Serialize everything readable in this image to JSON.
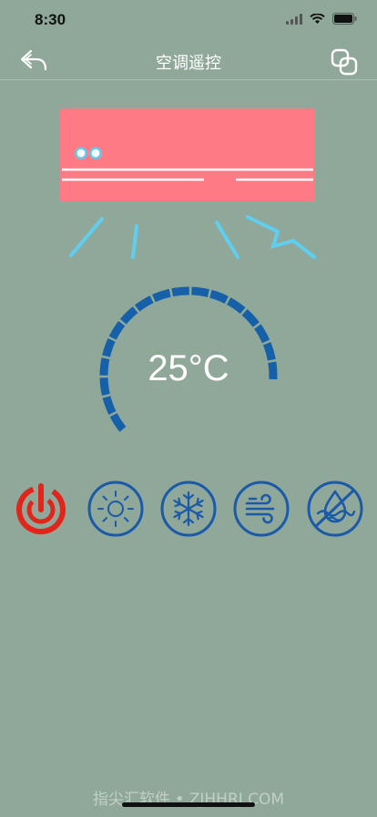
{
  "status_bar": {
    "time": "8:30"
  },
  "nav": {
    "title": "空调遥控"
  },
  "temperature": {
    "display": "25°C"
  },
  "gauge": {
    "level_fraction": 0.62
  },
  "modes": [
    {
      "id": "power",
      "icon": "power-icon",
      "color": "#e1251b",
      "active": true
    },
    {
      "id": "heat",
      "icon": "sun-icon",
      "color": "#1b5aa8",
      "active": false
    },
    {
      "id": "cool",
      "icon": "snowflake-icon",
      "color": "#1b5aa8",
      "active": false
    },
    {
      "id": "fan",
      "icon": "wind-icon",
      "color": "#1b5aa8",
      "active": false
    },
    {
      "id": "dry",
      "icon": "dehumidify-icon",
      "color": "#1b5aa8",
      "active": false
    }
  ],
  "colors": {
    "background": "#8fa89a",
    "ac_body": "#fe7b85",
    "airflow": "#5ecff0",
    "gauge": "#1560a8",
    "power": "#e1251b",
    "mode": "#1b5aa8"
  },
  "watermark": "指尖汇软件 • ZJHHRJ.COM"
}
